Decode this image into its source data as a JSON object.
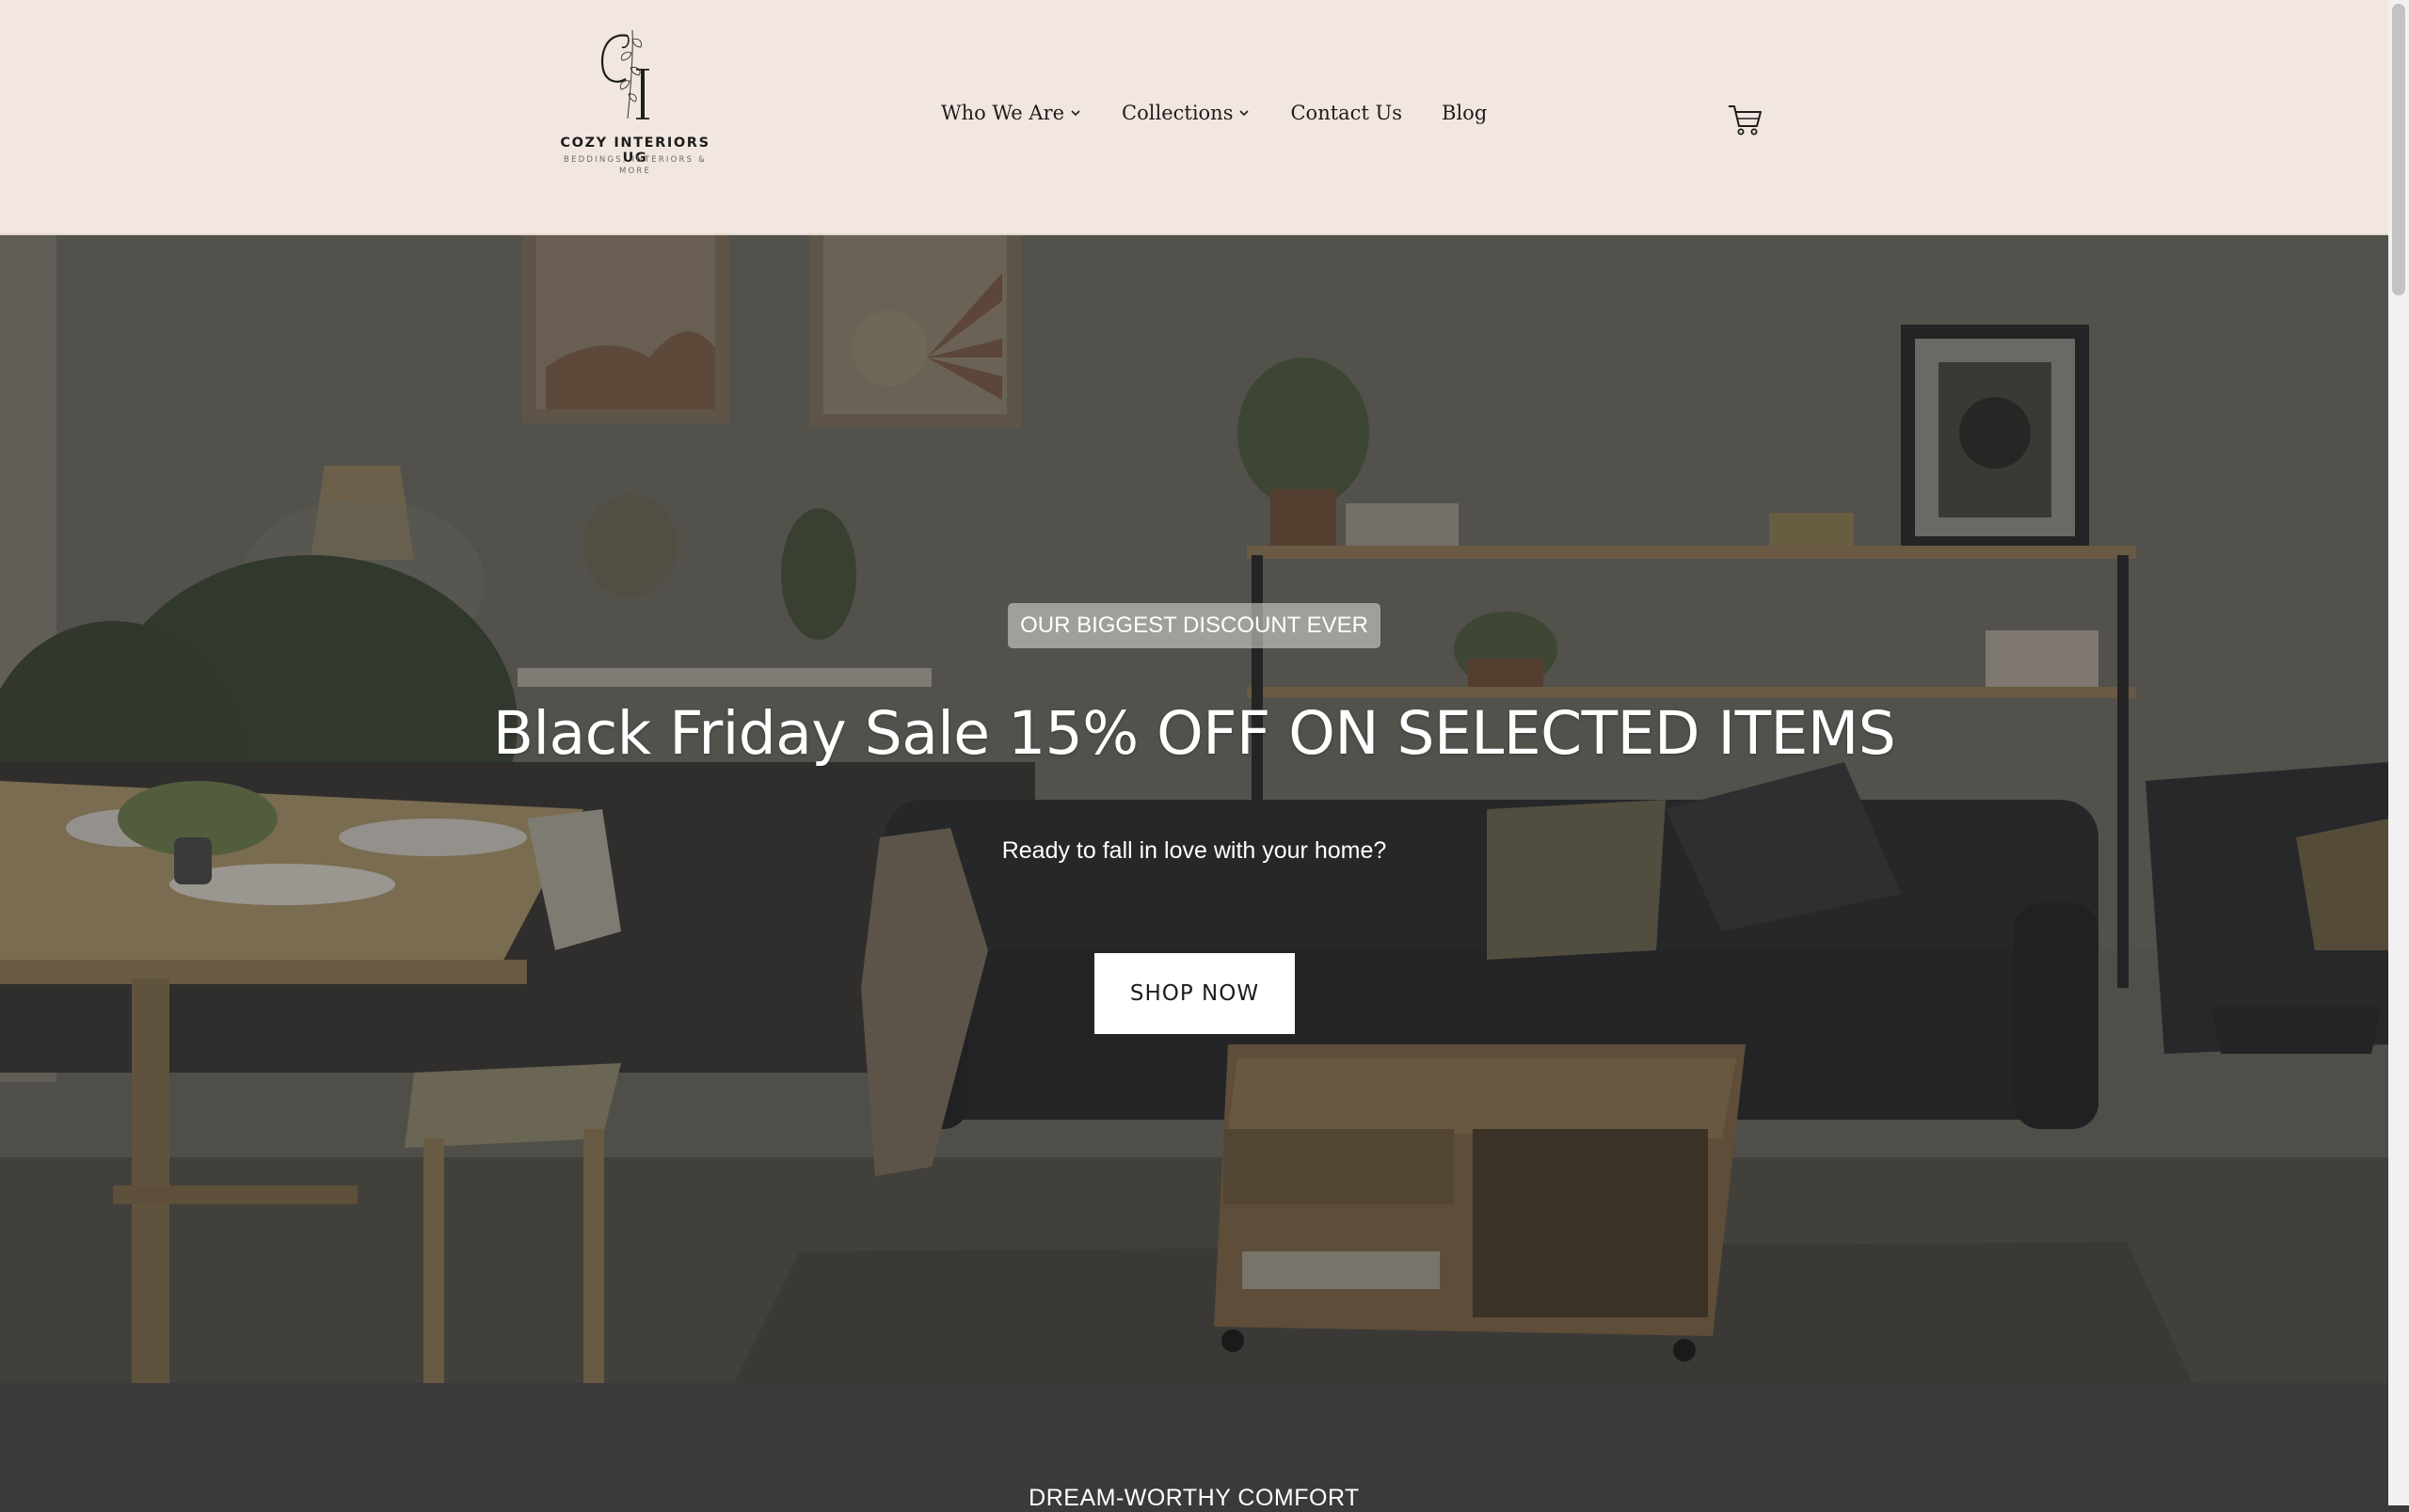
{
  "brand": {
    "name": "COZY INTERIORS UG",
    "tagline": "BEDDINGS, INTERIORS & MORE"
  },
  "nav": {
    "items": [
      {
        "label": "Who We Are",
        "has_dropdown": true
      },
      {
        "label": "Collections",
        "has_dropdown": true
      },
      {
        "label": "Contact Us",
        "has_dropdown": false
      },
      {
        "label": "Blog",
        "has_dropdown": false
      }
    ],
    "cart_icon": "shopping-cart-icon"
  },
  "hero": {
    "badge": "OUR BIGGEST DISCOUNT EVER",
    "title": "Black Friday Sale 15% OFF ON SELECTED ITEMS",
    "subtitle": "Ready to fall in love with your home?",
    "cta_label": "SHOP NOW"
  },
  "section": {
    "heading": "DREAM-WORTHY COMFORT"
  },
  "colors": {
    "header_bg": "#f2e7e0",
    "section_bg": "#3a3a3a",
    "text_dark": "#1d1d1d",
    "button_bg": "#ffffff"
  }
}
